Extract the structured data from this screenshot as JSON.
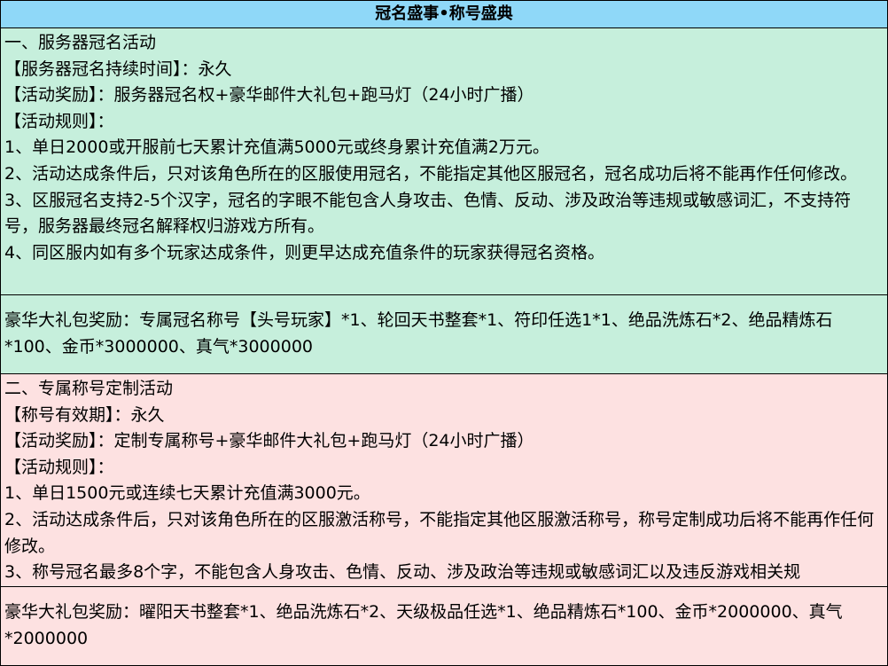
{
  "title": "冠名盛事•称号盛典",
  "section1": {
    "lines": [
      "一、服务器冠名活动",
      "【服务器冠名持续时间】：永久",
      "【活动奖励】：服务器冠名权+豪华邮件大礼包+跑马灯（24小时广播）",
      "【活动规则】：",
      "1、单日2000或开服前七天累计充值满5000元或终身累计充值满2万元。",
      "2、活动达成条件后，只对该角色所在的区服使用冠名，不能指定其他区服冠名，冠名成功后将不能再作任何修改。",
      "3、区服冠名支持2-5个汉字，冠名的字眼不能包含人身攻击、色情、反动、涉及政治等违规或敏感词汇，不支持符号，服务器最终冠名解释权归游戏方所有。",
      "4、同区服内如有多个玩家达成条件，则更早达成充值条件的玩家获得冠名资格。"
    ]
  },
  "reward1": "豪华大礼包奖励：专属冠名称号【头号玩家】*1、轮回天书整套*1、符印任选1*1、绝品洗炼石*2、绝品精炼石*100、金币*3000000、真气*3000000",
  "section2": {
    "lines": [
      "二、专属称号定制活动",
      "【称号有效期】：永久",
      "【活动奖励】：定制专属称号+豪华邮件大礼包+跑马灯（24小时广播）",
      "【活动规则】：",
      "1、单日1500元或连续七天累计充值满3000元。",
      "2、活动达成条件后，只对该角色所在的区服激活称号，不能指定其他区服激活称号，称号定制成功后将不能再作任何修改。",
      "3、称号冠名最多8个字，不能包含人身攻击、色情、反动、涉及政治等违规或敏感词汇以及违反游戏相关规"
    ]
  },
  "reward2": "豪华大礼包奖励：曜阳天书整套*1、绝品洗炼石*2、天级极品任选*1、绝品精炼石*100、金币*2000000、真气*2000000",
  "colors": {
    "title_bg": "#8fd8f8",
    "green_bg": "#c6efdc",
    "pink_bg": "#fde1e1"
  }
}
